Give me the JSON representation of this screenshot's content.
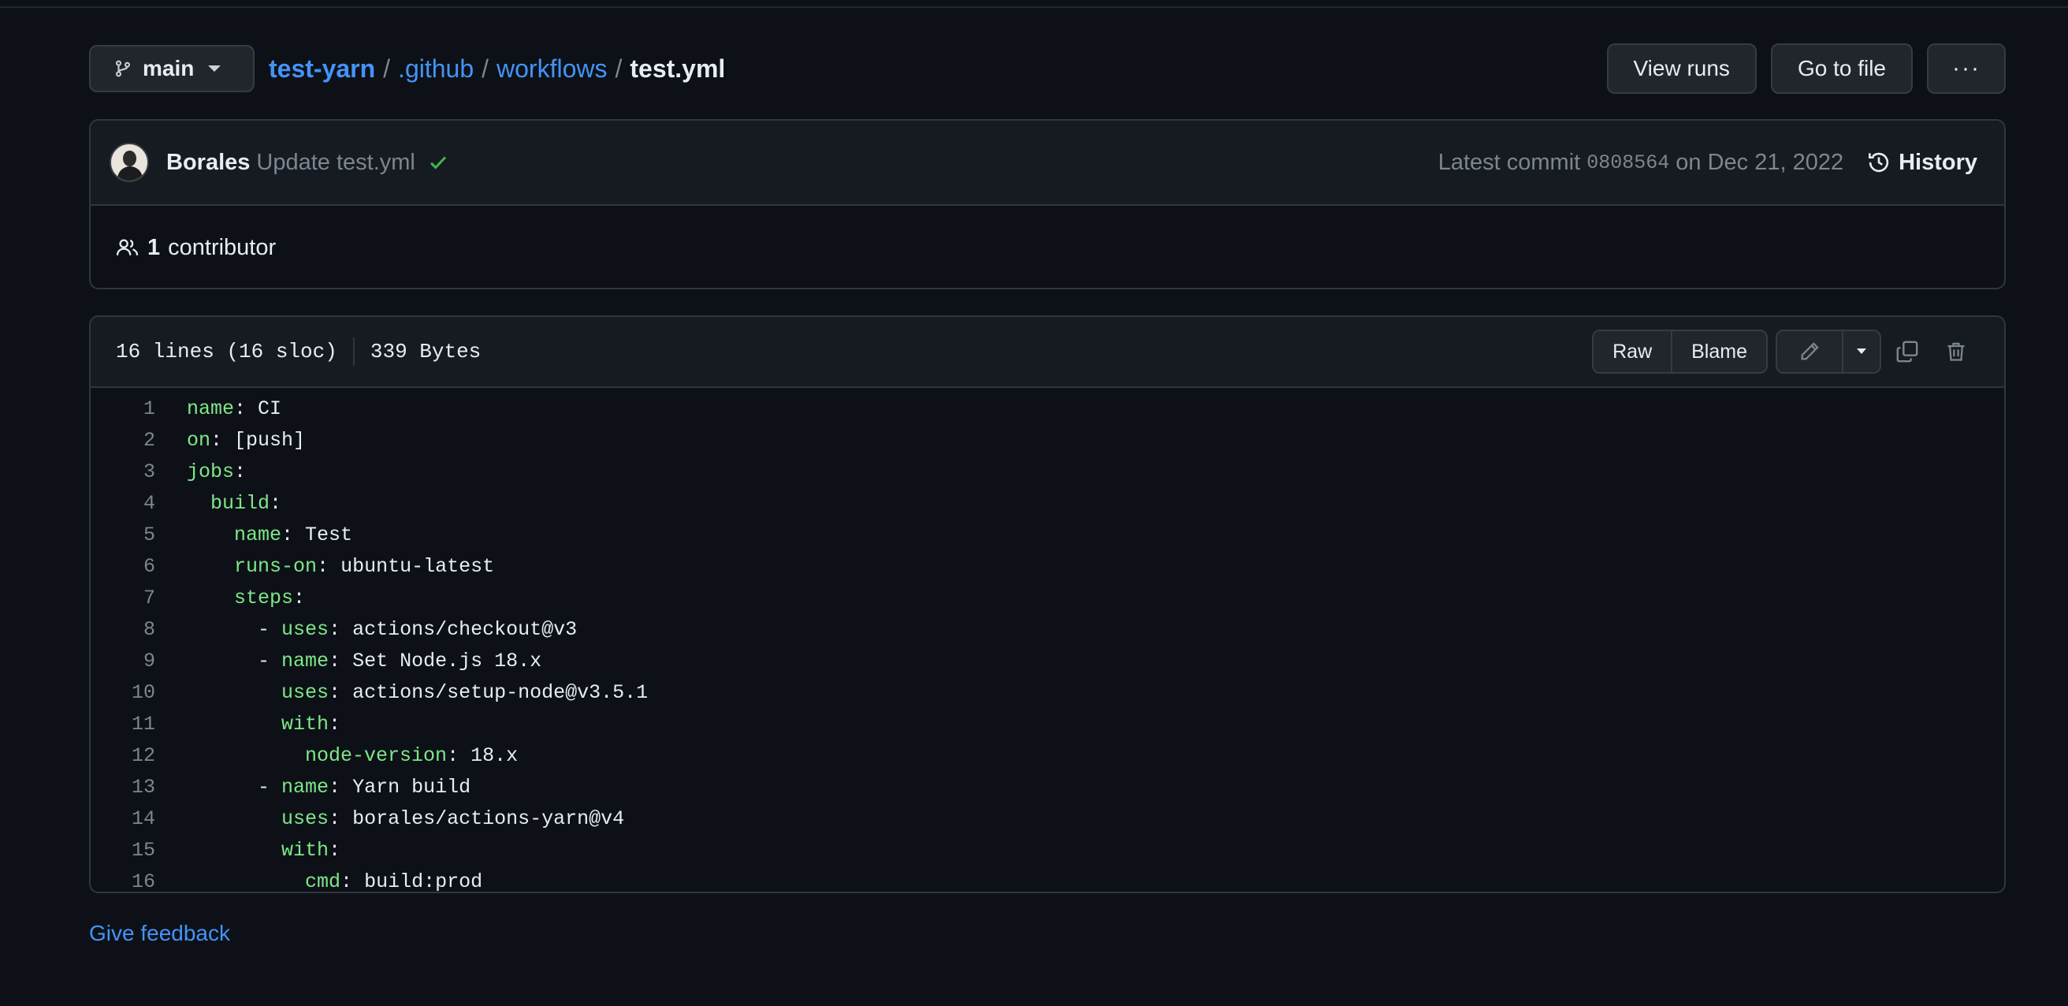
{
  "header": {
    "branch": "main",
    "breadcrumb": {
      "repo": "test-yarn",
      "sep": "/",
      "dir1": ".github",
      "dir2": "workflows",
      "file": "test.yml"
    },
    "actions": {
      "view_runs": "View runs",
      "go_to_file": "Go to file",
      "more": "···"
    }
  },
  "commit": {
    "author": "Borales",
    "message": "Update test.yml",
    "latest_label": "Latest commit",
    "sha": "0808564",
    "date_text": "on Dec 21, 2022",
    "history_label": "History",
    "contributor_count": "1",
    "contributor_label": "contributor"
  },
  "file": {
    "lines_info": "16 lines (16 sloc)",
    "size_info": "339 Bytes",
    "raw_label": "Raw",
    "blame_label": "Blame",
    "lines": [
      {
        "n": "1",
        "indent": "",
        "key": "name",
        "value": " CI"
      },
      {
        "n": "2",
        "indent": "",
        "key": "on",
        "value": " [push]"
      },
      {
        "n": "3",
        "indent": "",
        "key": "jobs",
        "value": ""
      },
      {
        "n": "4",
        "indent": "  ",
        "key": "build",
        "value": ""
      },
      {
        "n": "5",
        "indent": "    ",
        "key": "name",
        "value": " Test"
      },
      {
        "n": "6",
        "indent": "    ",
        "key": "runs-on",
        "value": " ubuntu-latest"
      },
      {
        "n": "7",
        "indent": "    ",
        "key": "steps",
        "value": ""
      },
      {
        "n": "8",
        "indent": "      - ",
        "key": "uses",
        "value": " actions/checkout@v3"
      },
      {
        "n": "9",
        "indent": "      - ",
        "key": "name",
        "value": " Set Node.js 18.x"
      },
      {
        "n": "10",
        "indent": "        ",
        "key": "uses",
        "value": " actions/setup-node@v3.5.1"
      },
      {
        "n": "11",
        "indent": "        ",
        "key": "with",
        "value": ""
      },
      {
        "n": "12",
        "indent": "          ",
        "key": "node-version",
        "value": " 18.x"
      },
      {
        "n": "13",
        "indent": "      - ",
        "key": "name",
        "value": " Yarn build"
      },
      {
        "n": "14",
        "indent": "        ",
        "key": "uses",
        "value": " borales/actions-yarn@v4"
      },
      {
        "n": "15",
        "indent": "        ",
        "key": "with",
        "value": ""
      },
      {
        "n": "16",
        "indent": "          ",
        "key": "cmd",
        "value": " build:prod"
      }
    ]
  },
  "footer": {
    "feedback": "Give feedback"
  },
  "colors": {
    "background": "#0d1117",
    "link": "#4493f8",
    "yaml_key": "#7ee787",
    "success": "#3fb950"
  }
}
